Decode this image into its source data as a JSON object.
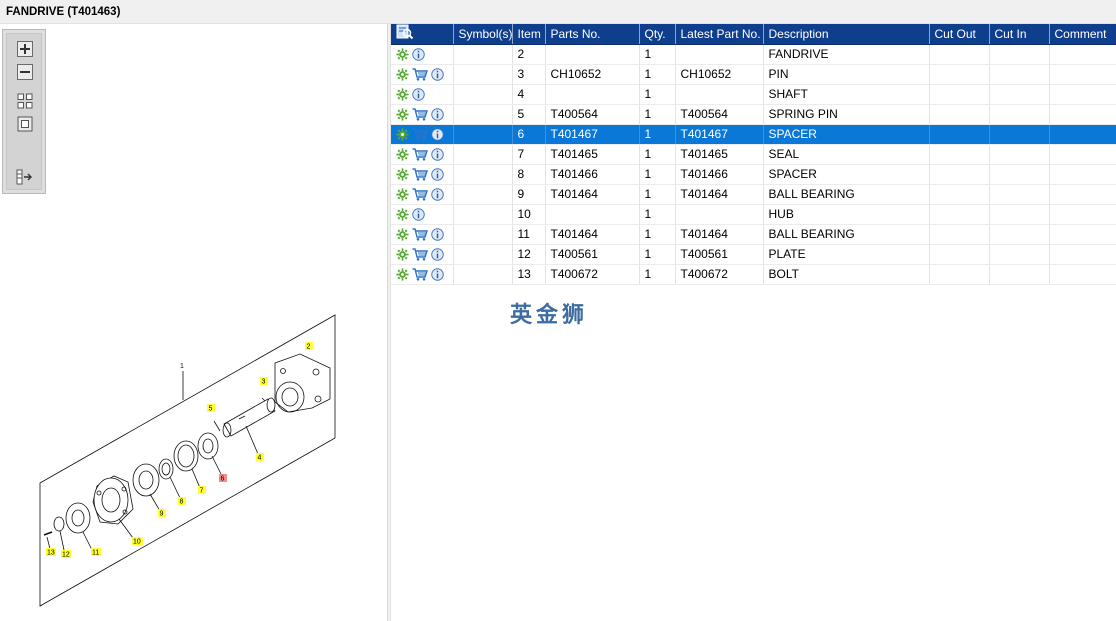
{
  "window": {
    "title": "FANDRIVE (T401463)"
  },
  "colors": {
    "header_bg": "#0f3f8c",
    "selected_row": "#0a78d7",
    "callout_yellow": "#ffff33",
    "callout_red": "#f28b8b",
    "watermark": "#2e5f9a"
  },
  "toolbox": {
    "tools": [
      {
        "icon": "zoom-in-icon"
      },
      {
        "icon": "zoom-out-icon"
      },
      {
        "icon": "fit-all-icon"
      },
      {
        "icon": "fit-window-icon"
      },
      {
        "icon": "toggle-panel-icon"
      }
    ]
  },
  "grid": {
    "columns": [
      "",
      "Symbol(s)",
      "Item",
      "Parts No.",
      "Qty.",
      "Latest Part No.",
      "Description",
      "Cut Out",
      "Cut In",
      "Comment"
    ],
    "header_icon": "search-parts-icon",
    "row_icons": {
      "settings": "gear-icon",
      "cart": "cart-icon",
      "info": "info-icon"
    },
    "rows": [
      {
        "item": "2",
        "parts_no": "",
        "qty": "1",
        "latest": "",
        "desc": "FANDRIVE",
        "cart": false,
        "selected": false
      },
      {
        "item": "3",
        "parts_no": "CH10652",
        "qty": "1",
        "latest": "CH10652",
        "desc": "PIN",
        "cart": true,
        "selected": false
      },
      {
        "item": "4",
        "parts_no": "",
        "qty": "1",
        "latest": "",
        "desc": "SHAFT",
        "cart": false,
        "selected": false
      },
      {
        "item": "5",
        "parts_no": "T400564",
        "qty": "1",
        "latest": "T400564",
        "desc": "SPRING PIN",
        "cart": true,
        "selected": false
      },
      {
        "item": "6",
        "parts_no": "T401467",
        "qty": "1",
        "latest": "T401467",
        "desc": "SPACER",
        "cart": true,
        "selected": true
      },
      {
        "item": "7",
        "parts_no": "T401465",
        "qty": "1",
        "latest": "T401465",
        "desc": "SEAL",
        "cart": true,
        "selected": false
      },
      {
        "item": "8",
        "parts_no": "T401466",
        "qty": "1",
        "latest": "T401466",
        "desc": "SPACER",
        "cart": true,
        "selected": false
      },
      {
        "item": "9",
        "parts_no": "T401464",
        "qty": "1",
        "latest": "T401464",
        "desc": "BALL BEARING",
        "cart": true,
        "selected": false
      },
      {
        "item": "10",
        "parts_no": "",
        "qty": "1",
        "latest": "",
        "desc": "HUB",
        "cart": false,
        "selected": false
      },
      {
        "item": "11",
        "parts_no": "T401464",
        "qty": "1",
        "latest": "T401464",
        "desc": "BALL BEARING",
        "cart": true,
        "selected": false
      },
      {
        "item": "12",
        "parts_no": "T400561",
        "qty": "1",
        "latest": "T400561",
        "desc": "PLATE",
        "cart": true,
        "selected": false
      },
      {
        "item": "13",
        "parts_no": "T400672",
        "qty": "1",
        "latest": "T400672",
        "desc": "BOLT",
        "cart": true,
        "selected": false
      }
    ]
  },
  "watermark": "英金狮",
  "diagram": {
    "assembly_label": "1",
    "callouts": [
      {
        "label": "2",
        "state": "normal"
      },
      {
        "label": "3",
        "state": "normal"
      },
      {
        "label": "4",
        "state": "normal"
      },
      {
        "label": "5",
        "state": "normal"
      },
      {
        "label": "6",
        "state": "selected"
      },
      {
        "label": "7",
        "state": "normal"
      },
      {
        "label": "8",
        "state": "normal"
      },
      {
        "label": "9",
        "state": "normal"
      },
      {
        "label": "10",
        "state": "normal"
      },
      {
        "label": "11",
        "state": "normal"
      },
      {
        "label": "12",
        "state": "normal"
      },
      {
        "label": "13",
        "state": "normal"
      }
    ]
  }
}
